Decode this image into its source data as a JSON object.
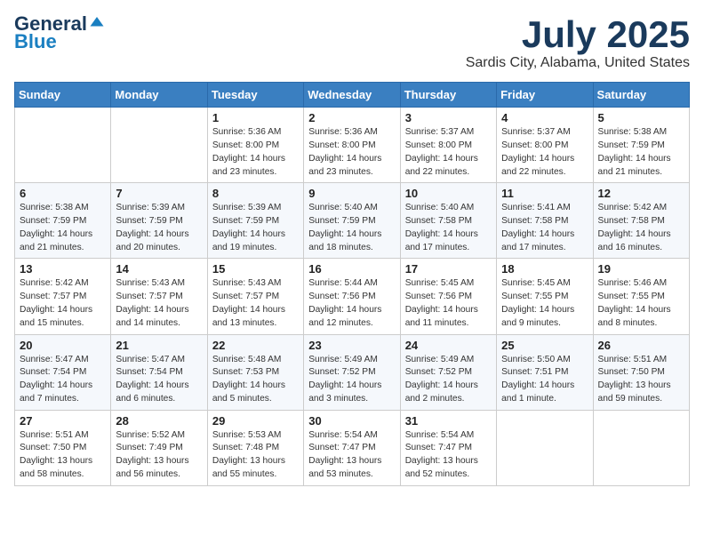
{
  "header": {
    "logo_general": "General",
    "logo_blue": "Blue",
    "month_title": "July 2025",
    "location": "Sardis City, Alabama, United States"
  },
  "days_of_week": [
    "Sunday",
    "Monday",
    "Tuesday",
    "Wednesday",
    "Thursday",
    "Friday",
    "Saturday"
  ],
  "weeks": [
    [
      {
        "day": "",
        "info": ""
      },
      {
        "day": "",
        "info": ""
      },
      {
        "day": "1",
        "info": "Sunrise: 5:36 AM\nSunset: 8:00 PM\nDaylight: 14 hours and 23 minutes."
      },
      {
        "day": "2",
        "info": "Sunrise: 5:36 AM\nSunset: 8:00 PM\nDaylight: 14 hours and 23 minutes."
      },
      {
        "day": "3",
        "info": "Sunrise: 5:37 AM\nSunset: 8:00 PM\nDaylight: 14 hours and 22 minutes."
      },
      {
        "day": "4",
        "info": "Sunrise: 5:37 AM\nSunset: 8:00 PM\nDaylight: 14 hours and 22 minutes."
      },
      {
        "day": "5",
        "info": "Sunrise: 5:38 AM\nSunset: 7:59 PM\nDaylight: 14 hours and 21 minutes."
      }
    ],
    [
      {
        "day": "6",
        "info": "Sunrise: 5:38 AM\nSunset: 7:59 PM\nDaylight: 14 hours and 21 minutes."
      },
      {
        "day": "7",
        "info": "Sunrise: 5:39 AM\nSunset: 7:59 PM\nDaylight: 14 hours and 20 minutes."
      },
      {
        "day": "8",
        "info": "Sunrise: 5:39 AM\nSunset: 7:59 PM\nDaylight: 14 hours and 19 minutes."
      },
      {
        "day": "9",
        "info": "Sunrise: 5:40 AM\nSunset: 7:59 PM\nDaylight: 14 hours and 18 minutes."
      },
      {
        "day": "10",
        "info": "Sunrise: 5:40 AM\nSunset: 7:58 PM\nDaylight: 14 hours and 17 minutes."
      },
      {
        "day": "11",
        "info": "Sunrise: 5:41 AM\nSunset: 7:58 PM\nDaylight: 14 hours and 17 minutes."
      },
      {
        "day": "12",
        "info": "Sunrise: 5:42 AM\nSunset: 7:58 PM\nDaylight: 14 hours and 16 minutes."
      }
    ],
    [
      {
        "day": "13",
        "info": "Sunrise: 5:42 AM\nSunset: 7:57 PM\nDaylight: 14 hours and 15 minutes."
      },
      {
        "day": "14",
        "info": "Sunrise: 5:43 AM\nSunset: 7:57 PM\nDaylight: 14 hours and 14 minutes."
      },
      {
        "day": "15",
        "info": "Sunrise: 5:43 AM\nSunset: 7:57 PM\nDaylight: 14 hours and 13 minutes."
      },
      {
        "day": "16",
        "info": "Sunrise: 5:44 AM\nSunset: 7:56 PM\nDaylight: 14 hours and 12 minutes."
      },
      {
        "day": "17",
        "info": "Sunrise: 5:45 AM\nSunset: 7:56 PM\nDaylight: 14 hours and 11 minutes."
      },
      {
        "day": "18",
        "info": "Sunrise: 5:45 AM\nSunset: 7:55 PM\nDaylight: 14 hours and 9 minutes."
      },
      {
        "day": "19",
        "info": "Sunrise: 5:46 AM\nSunset: 7:55 PM\nDaylight: 14 hours and 8 minutes."
      }
    ],
    [
      {
        "day": "20",
        "info": "Sunrise: 5:47 AM\nSunset: 7:54 PM\nDaylight: 14 hours and 7 minutes."
      },
      {
        "day": "21",
        "info": "Sunrise: 5:47 AM\nSunset: 7:54 PM\nDaylight: 14 hours and 6 minutes."
      },
      {
        "day": "22",
        "info": "Sunrise: 5:48 AM\nSunset: 7:53 PM\nDaylight: 14 hours and 5 minutes."
      },
      {
        "day": "23",
        "info": "Sunrise: 5:49 AM\nSunset: 7:52 PM\nDaylight: 14 hours and 3 minutes."
      },
      {
        "day": "24",
        "info": "Sunrise: 5:49 AM\nSunset: 7:52 PM\nDaylight: 14 hours and 2 minutes."
      },
      {
        "day": "25",
        "info": "Sunrise: 5:50 AM\nSunset: 7:51 PM\nDaylight: 14 hours and 1 minute."
      },
      {
        "day": "26",
        "info": "Sunrise: 5:51 AM\nSunset: 7:50 PM\nDaylight: 13 hours and 59 minutes."
      }
    ],
    [
      {
        "day": "27",
        "info": "Sunrise: 5:51 AM\nSunset: 7:50 PM\nDaylight: 13 hours and 58 minutes."
      },
      {
        "day": "28",
        "info": "Sunrise: 5:52 AM\nSunset: 7:49 PM\nDaylight: 13 hours and 56 minutes."
      },
      {
        "day": "29",
        "info": "Sunrise: 5:53 AM\nSunset: 7:48 PM\nDaylight: 13 hours and 55 minutes."
      },
      {
        "day": "30",
        "info": "Sunrise: 5:54 AM\nSunset: 7:47 PM\nDaylight: 13 hours and 53 minutes."
      },
      {
        "day": "31",
        "info": "Sunrise: 5:54 AM\nSunset: 7:47 PM\nDaylight: 13 hours and 52 minutes."
      },
      {
        "day": "",
        "info": ""
      },
      {
        "day": "",
        "info": ""
      }
    ]
  ]
}
